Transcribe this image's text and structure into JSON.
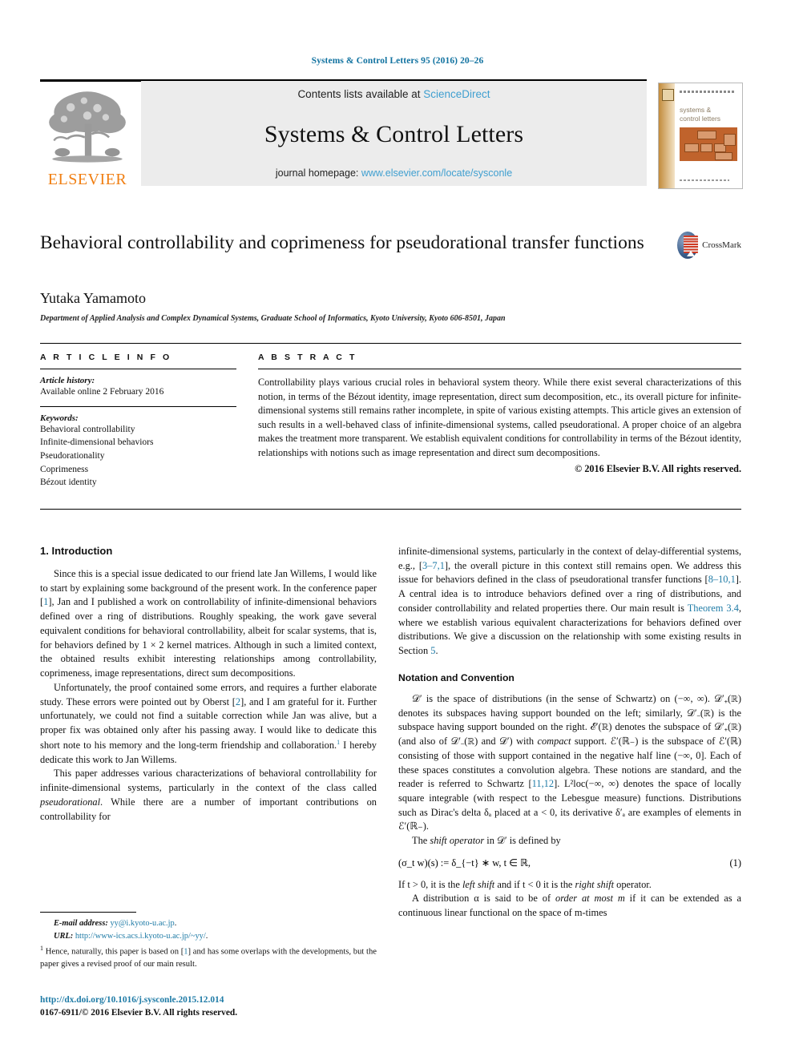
{
  "running_head": "Systems & Control Letters 95 (2016) 20–26",
  "masthead": {
    "publisher": "ELSEVIER",
    "contents_prefix": "Contents lists available at ",
    "contents_link": "ScienceDirect",
    "journal_title": "Systems & Control Letters",
    "homepage_prefix": "journal homepage: ",
    "homepage_url": "www.elsevier.com/locate/sysconle",
    "cover_title": "systems &\ncontrol letters"
  },
  "crossmark": {
    "label": "CrossMark"
  },
  "article": {
    "title": "Behavioral controllability and coprimeness for pseudorational transfer functions",
    "author": "Yutaka Yamamoto",
    "affiliation": "Department of Applied Analysis and Complex Dynamical Systems, Graduate School of Informatics, Kyoto University, Kyoto 606-8501, Japan"
  },
  "article_info": {
    "heading": "A R T I C L E   I N F O",
    "history_label": "Article history:",
    "history_value": "Available online 2 February 2016",
    "keywords_label": "Keywords:",
    "keywords": [
      "Behavioral controllability",
      "Infinite-dimensional behaviors",
      "Pseudorationality",
      "Coprimeness",
      "Bézout identity"
    ]
  },
  "abstract": {
    "heading": "A B S T R A C T",
    "text": "Controllability plays various crucial roles in behavioral system theory. While there exist several characterizations of this notion, in terms of the Bézout identity, image representation, direct sum decomposition, etc., its overall picture for infinite-dimensional systems still remains rather incomplete, in spite of various existing attempts. This article gives an extension of such results in a well-behaved class of infinite-dimensional systems, called pseudorational. A proper choice of an algebra makes the treatment more transparent. We establish equivalent conditions for controllability in terms of the Bézout identity, relationships with notions such as image representation and direct sum decompositions.",
    "copyright": "© 2016 Elsevier B.V. All rights reserved."
  },
  "sections": {
    "introduction_heading": "1. Introduction",
    "notation_heading": "Notation and Convention"
  },
  "body": {
    "p1_a": "Since this is a special issue dedicated to our friend late Jan Willems, I would like to start by explaining some background of the present work. In the conference paper [",
    "p1_ref1": "1",
    "p1_b": "], Jan and I published a work on controllability of infinite-dimensional behaviors defined over a ring of distributions. Roughly speaking, the work gave several equivalent conditions for behavioral controllability, albeit for scalar systems, that is, for behaviors defined by 1 × 2 kernel matrices. Although in such a limited context, the obtained results exhibit interesting relationships among controllability, coprimeness, image representations, direct sum decompositions.",
    "p2_a": "Unfortunately, the proof contained some errors, and requires a further elaborate study. These errors were pointed out by Oberst [",
    "p2_ref": "2",
    "p2_b": "], and I am grateful for it. Further unfortunately, we could not find a suitable correction while Jan was alive, but a proper fix was obtained only after his passing away. I would like to dedicate this short note to his memory and the long-term friendship and collaboration.",
    "p2_fnmark": "1",
    "p2_c": " I hereby dedicate this work to Jan Willems.",
    "p3_a": "This paper addresses various characterizations of behavioral controllability for infinite-dimensional systems, particularly in the context of the class called ",
    "p3_it": "pseudorational",
    "p3_b": ". While there are a number of important contributions on controllability for",
    "p4_a": "infinite-dimensional systems, particularly in the context of delay-differential systems, e.g., [",
    "p4_ref1": "3–7,1",
    "p4_b": "], the overall picture in this context still remains open. We address this issue for behaviors defined in the class of pseudorational transfer functions [",
    "p4_ref2": "8–10,1",
    "p4_c": "]. A central idea is to introduce behaviors defined over a ring of distributions, and consider controllability and related properties there. Our main result is ",
    "p4_thm": "Theorem 3.4",
    "p4_d": ", where we establish various equivalent characterizations for behaviors defined over distributions. We give a discussion on the relationship with some existing results in Section ",
    "p4_sec": "5",
    "p4_e": ".",
    "n1_a": "𝒟′ is the space of distributions (in the sense of Schwartz) on (−∞, ∞). 𝒟′₊(ℝ) denotes its subspaces having support bounded on the left; similarly, 𝒟′₋(ℝ) is the subspace having support bounded on the right. ℰ′(ℝ) denotes the subspace of 𝒟′₊(ℝ) (and also of 𝒟′₋(ℝ) and 𝒟′) with ",
    "n1_it": "compact",
    "n1_b": " support. ℰ′(ℝ₋) is the subspace of ℰ′(ℝ) consisting of those with support contained in the negative half line (−∞, 0]. Each of these spaces constitutes a convolution algebra. These notions are standard, and the reader is referred to Schwartz [",
    "n1_ref": "11,12",
    "n1_c": "]. L²loc(−∞, ∞) denotes the space of locally square integrable (with respect to the Lebesgue measure) functions. Distributions such as Dirac's delta δₐ placed at a < 0, its derivative δ′ₐ are examples of elements in ℰ′(ℝ₋).",
    "n2_a": "The ",
    "n2_it": "shift operator",
    "n2_b": " in 𝒟′ is defined by",
    "eq1_text": "(σ_t w)(s) := δ_{−t} ∗ w,    t ∈ ℝ,",
    "eq1_tag": "(1)",
    "n3_a": "If t > 0, it is the ",
    "n3_it1": "left shift",
    "n3_b": " and if t < 0 it is the ",
    "n3_it2": "right shift",
    "n3_c": " operator.",
    "n4_a": "A distribution α is said to be of ",
    "n4_it": "order at most m",
    "n4_b": " if it can be extended as a continuous linear functional on the space of m-times"
  },
  "footnotes": {
    "email_label": "E-mail address:",
    "email": "yy@i.kyoto-u.ac.jp",
    "email_tail": ".",
    "url_label": "URL:",
    "url": "http://www-ics.acs.i.kyoto-u.ac.jp/~yy/",
    "url_tail": ".",
    "note_mark": "1",
    "note_a": " Hence, naturally, this paper is based on [",
    "note_ref": "1",
    "note_b": "] and has some overlaps with the developments, but the paper gives a revised proof of our main result.",
    "doi": "http://dx.doi.org/10.1016/j.sysconle.2015.12.014",
    "issn": "0167-6911/© 2016 Elsevier B.V. All rights reserved."
  },
  "colors": {
    "link": "#1f7ba6",
    "elsevier_orange": "#f07f13",
    "panel_grey": "#ececec"
  }
}
